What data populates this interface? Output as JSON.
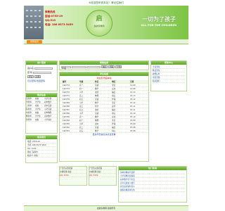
{
  "top_bar": {
    "text": "※欢迎您来到本站！请记住我们"
  },
  "banner": {
    "phone_lines": [
      "家教热线",
      "固话:0755-29",
      "QQ:515",
      "电话: 186 6573 5459"
    ],
    "circle_big": "启",
    "circle_small": "启航家教网",
    "slogan_cn": "一切为了孩子",
    "slogan_en": "ALL FOR THE CHILDREN"
  },
  "nav": {
    "button": "家教首页"
  },
  "login": {
    "title": "用户登录",
    "user_label": "用户名",
    "pass_label": "密 码",
    "buttons": [
      "登录",
      "注册"
    ],
    "links": [
      "忘记密码",
      "找回密码"
    ]
  },
  "search": {
    "title": "家教检索",
    "select": "年级",
    "buttons": [
      "确定",
      "查看",
      "全部"
    ]
  },
  "news": {
    "title": "学生信息",
    "notice": "欢迎您光临本站",
    "headers": [
      "编号",
      "年级",
      "科目",
      "地区",
      "日期"
    ],
    "rows": [
      [
        "192774",
        "高一",
        "英语",
        "宝安",
        "12-09"
      ],
      [
        "192773",
        "初一",
        "数学",
        "龙岗",
        "12-08"
      ],
      [
        "192772",
        "小学",
        "语文",
        "福田",
        "07-13"
      ],
      [
        "192771",
        "高二",
        "物理",
        "南山",
        "07-13"
      ],
      [
        "192770",
        "初三",
        "英语",
        "罗湖",
        "07-12"
      ],
      [
        "192769",
        "小学",
        "数学",
        "宝安",
        "07-12"
      ],
      [
        "192768",
        "高三",
        "化学",
        "龙华",
        "07-11"
      ],
      [
        "192767",
        "初二",
        "语文",
        "福田",
        "07-11"
      ],
      [
        "192766",
        "小学",
        "英语",
        "南山",
        "07-10"
      ],
      [
        "192765",
        "高一",
        "数学",
        "龙岗",
        "07-10"
      ],
      [
        "192764",
        "初一",
        "物理",
        "宝安",
        "07-09"
      ],
      [
        "192763",
        "小学",
        "语文",
        "罗湖",
        "07-09"
      ],
      [
        "192762",
        "高二",
        "英语",
        "福田",
        "07-08"
      ],
      [
        "192761",
        "初三",
        "数学",
        "南山",
        "07-08"
      ]
    ],
    "bottom_note": "更多学员信息请点击查看"
  },
  "teachers": {
    "title": "教员信息",
    "rows": [
      [
        "张老师",
        "在职",
        "小学全科"
      ],
      [
        "李老师",
        "大学生",
        "初中数学"
      ],
      [
        "王老师",
        "在职",
        "高中英语"
      ],
      [
        "陈老师",
        "大学生",
        "小学英语"
      ],
      [
        "刘老师",
        "在职",
        "初中物理"
      ],
      [
        "杨老师",
        "大学生",
        "高中数学"
      ],
      [
        "黄老师",
        "在职",
        "小学语文"
      ]
    ]
  },
  "contact": {
    "title": "联系我们",
    "lines": [
      "电话: 0755-29",
      "手机: 186 6573 5459",
      "QQ: 5150",
      "地址: 深圳市",
      "联系人: 启航"
    ]
  },
  "help": {
    "title": "帮助中心",
    "links": [
      "学员须知",
      "教员须知",
      "收费标准",
      "常见问题",
      "联系我们"
    ]
  },
  "ads": [
    {
      "line1": "广告位火热招商",
      "line2": "价格优惠,欢迎",
      "line3": "QQ: 5150"
    },
    {
      "line1": "广告位火热招商",
      "line2": "价格优惠,欢迎",
      "line3": "QQ: 5150"
    }
  ],
  "hot": {
    "title": "热门新闻",
    "items": [
      "深圳家教如何选择",
      "小学家教注意事项",
      "初中数学学习方法",
      "高考英语复习技巧",
      "家长如何辅导孩子",
      "暑假家教需求火热"
    ]
  },
  "footer": {
    "text": "启航家教网 版权所有"
  }
}
